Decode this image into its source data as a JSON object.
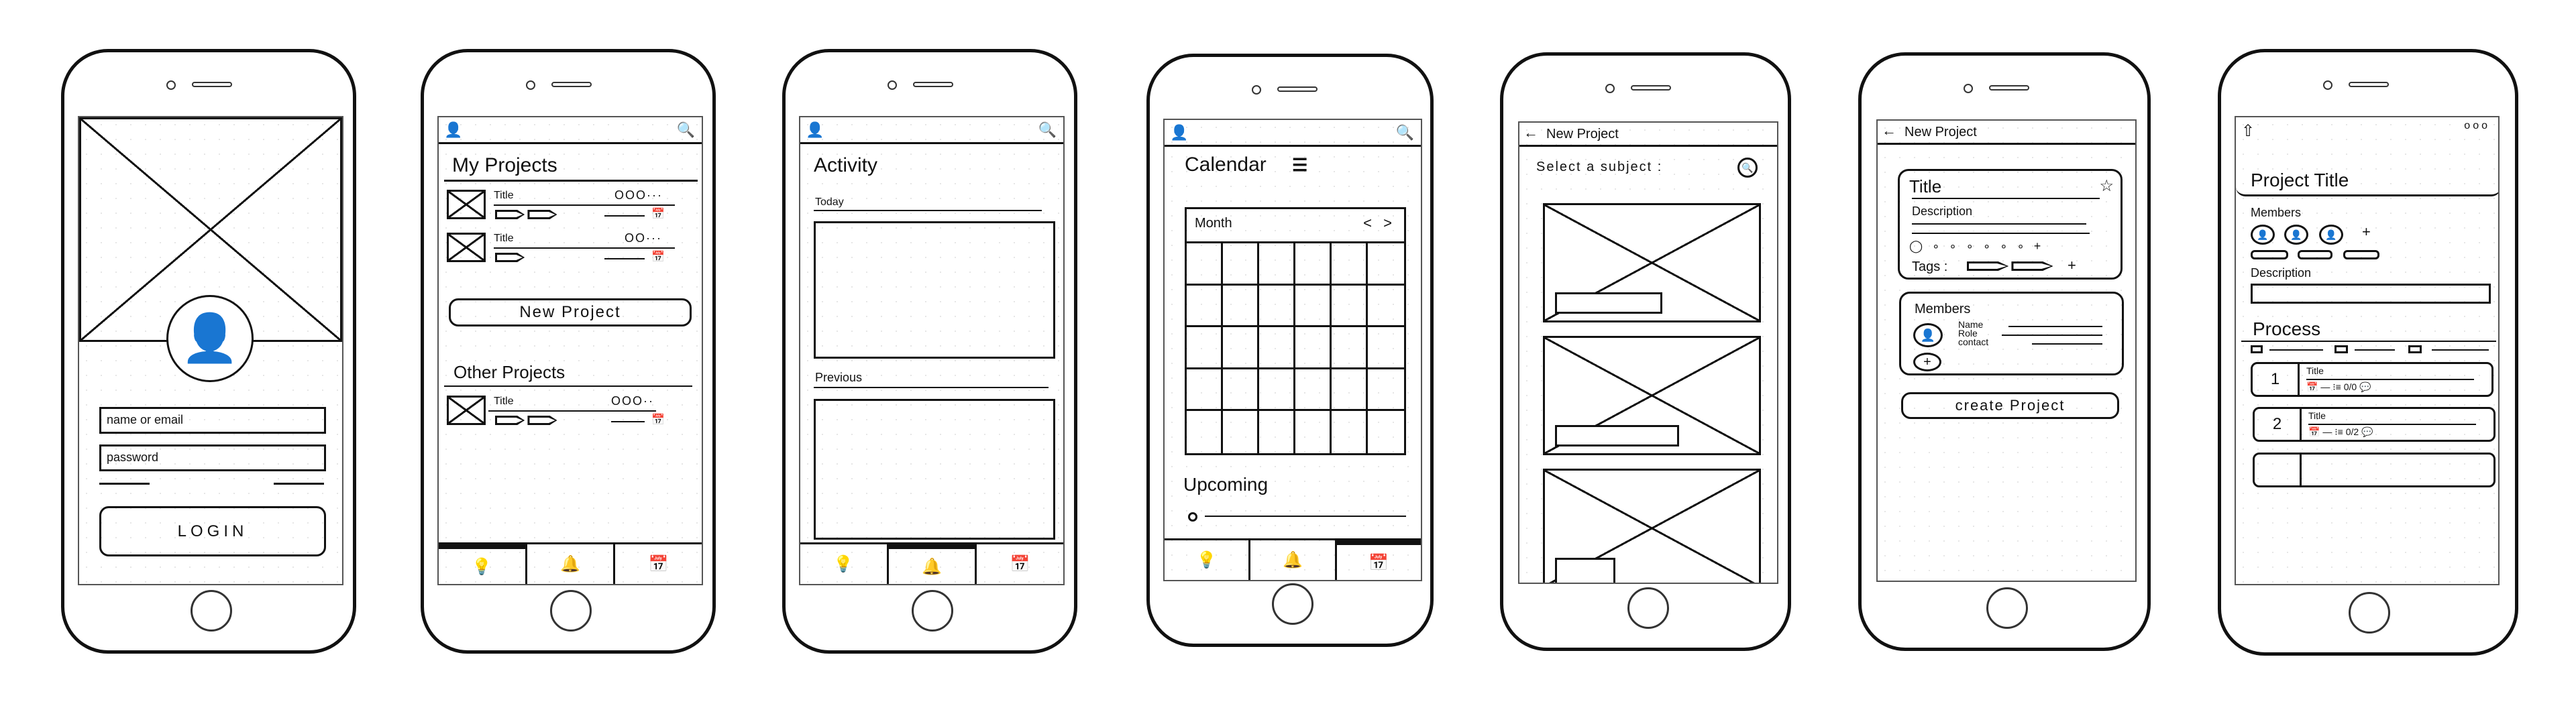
{
  "login": {
    "username_placeholder": "name or email",
    "password_placeholder": "password",
    "login_label": "LOGIN"
  },
  "projects": {
    "title": "My Projects",
    "my_projects": [
      {
        "title": "Title",
        "dots": "OOO···"
      },
      {
        "title": "Title",
        "dots": "OO···"
      }
    ],
    "new_project_label": "New Project",
    "other_title": "Other Projects",
    "other_projects": [
      {
        "title": "Title",
        "dots": "OOO··"
      }
    ]
  },
  "activity": {
    "title": "Activity",
    "today": "Today",
    "previous": "Previous"
  },
  "calendar": {
    "title": "Calendar",
    "month": "Month",
    "prev": "<",
    "next": ">",
    "upcoming": "Upcoming"
  },
  "select_subject": {
    "header": "New Project",
    "prompt": "Select a subject :"
  },
  "new_project": {
    "header": "New Project",
    "title_label": "Title",
    "description_label": "Description",
    "tags_label": "Tags :",
    "members_label": "Members",
    "name_label": "Name",
    "role_label": "Role",
    "contact_label": "contact",
    "plus": "+",
    "create_label": "create Project"
  },
  "project_detail": {
    "title": "Project Title",
    "more": "ooo",
    "members_label": "Members",
    "plus": "+",
    "description_label": "Description",
    "process_label": "Process",
    "steps": [
      {
        "number": "1",
        "title": "Title",
        "checklist": "0/0"
      },
      {
        "number": "2",
        "title": "Title",
        "checklist": "0/2"
      }
    ]
  },
  "icons": {
    "user": "user-icon",
    "search": "search-icon",
    "back": "arrow-left-icon",
    "lightbulb": "lightbulb-icon",
    "bell": "bell-icon",
    "calendar": "calendar-icon",
    "star": "star-icon",
    "filter": "sliders-icon",
    "share": "share-up-icon"
  }
}
